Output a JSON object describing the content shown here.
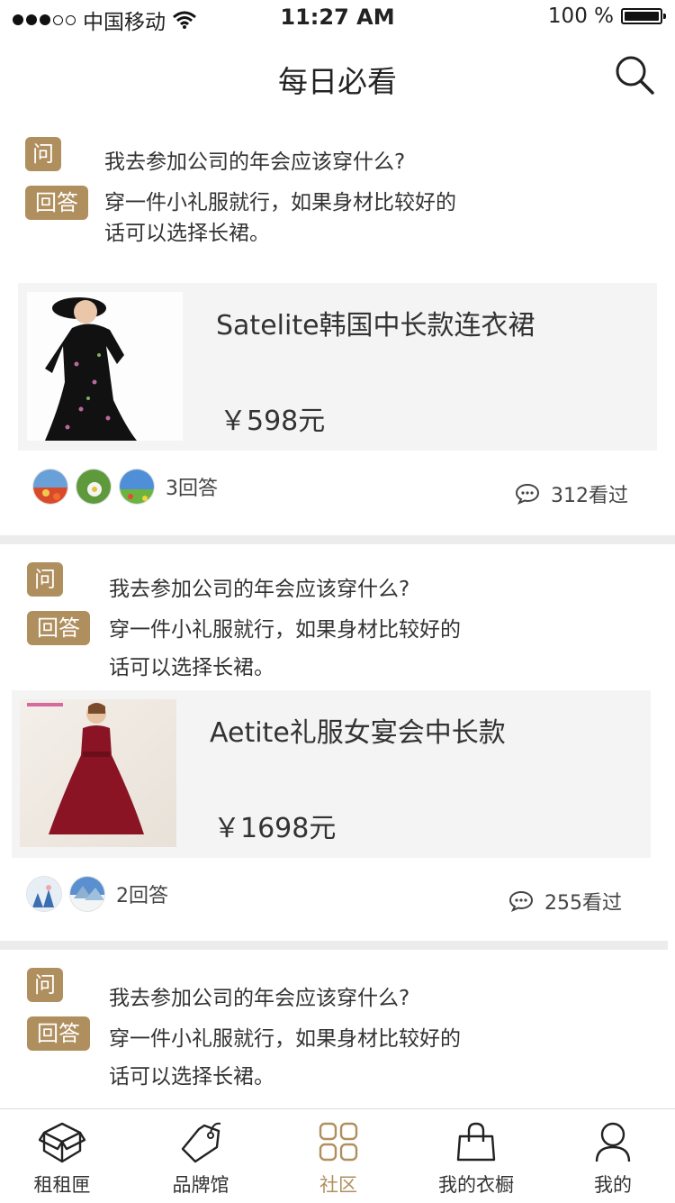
{
  "status": {
    "carrier": "中国移动",
    "time": "11:27 AM",
    "battery": "100 %"
  },
  "header": {
    "title": "每日必看"
  },
  "tag_question": "问",
  "tag_answer": "回答",
  "posts": [
    {
      "question": "我去参加公司的年会应该穿什么?",
      "answer_line1": "穿一件小礼服就行，如果身材比较好的",
      "answer_line2": "话可以选择长裙。",
      "product_name": "Satelite韩国中长款连衣裙",
      "price": "￥598元",
      "replies": "3回答",
      "views": "312看过"
    },
    {
      "question": "我去参加公司的年会应该穿什么?",
      "answer_line1": "穿一件小礼服就行，如果身材比较好的",
      "answer_line2": "话可以选择长裙。",
      "product_name": "Aetite礼服女宴会中长款",
      "price": "￥1698元",
      "replies": "2回答",
      "views": "255看过"
    },
    {
      "question": "我去参加公司的年会应该穿什么?",
      "answer_line1": "穿一件小礼服就行，如果身材比较好的",
      "answer_line2": "话可以选择长裙。"
    }
  ],
  "tabbar": [
    {
      "label": "租租匣",
      "icon": "box-icon"
    },
    {
      "label": "品牌馆",
      "icon": "tag-icon"
    },
    {
      "label": "社区",
      "icon": "grid-icon",
      "active": true
    },
    {
      "label": "我的衣橱",
      "icon": "bag-icon"
    },
    {
      "label": "我的",
      "icon": "user-icon"
    }
  ],
  "colors": {
    "accent": "#b08f5e",
    "card_bg": "#f4f4f4",
    "separator": "#ececec"
  }
}
